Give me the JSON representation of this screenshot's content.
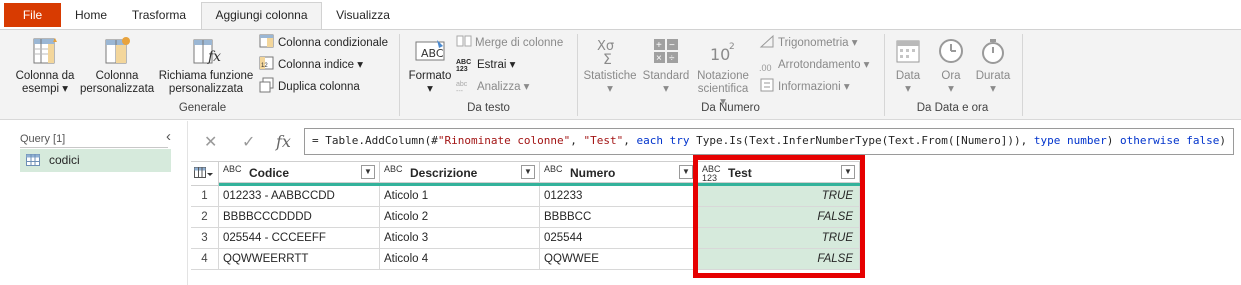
{
  "menu": {
    "tabs": [
      {
        "label": "File"
      },
      {
        "label": "Home"
      },
      {
        "label": "Trasforma"
      },
      {
        "label": "Aggiungi colonna"
      },
      {
        "label": "Visualizza"
      }
    ],
    "active_tab": "Aggiungi colonna",
    "file_color": "#d83b01"
  },
  "ribbon": {
    "generale": {
      "label": "Generale",
      "colonna_da_esempi": [
        "Colonna da",
        "esempi"
      ],
      "colonna_personalizzata": [
        "Colonna",
        "personalizzata"
      ],
      "richiama_funzione": [
        "Richiama funzione",
        "personalizzata"
      ],
      "colonna_condizionale": "Colonna condizionale",
      "colonna_indice": "Colonna indice",
      "duplica_colonna": "Duplica colonna"
    },
    "da_testo": {
      "label": "Da testo",
      "formato": "Formato",
      "merge_colonne": "Merge di colonne",
      "estrai": "Estrai",
      "analizza": "Analizza"
    },
    "da_numero": {
      "label": "Da Numero",
      "statistiche": "Statistiche",
      "standard": "Standard",
      "notazione_scientifica": [
        "Notazione",
        "scientifica"
      ],
      "trigonometria": "Trigonometria",
      "arrotondamento": "Arrotondamento",
      "informazioni": "Informazioni"
    },
    "da_data_ora": {
      "label": "Da Data e ora",
      "data": "Data",
      "ora": "Ora",
      "durata": "Durata"
    }
  },
  "query_pane": {
    "title": "Query [1]",
    "items": [
      {
        "label": "codici"
      }
    ]
  },
  "formula_bar": {
    "formula": "= Table.AddColumn(#\"Rinominate colonne\", \"Test\", each try Type.Is(Text.InferNumberType(Text.From([Numero])), type number) otherwise false)"
  },
  "grid": {
    "columns": [
      {
        "type_label": "ABC",
        "name": "Codice"
      },
      {
        "type_label": "ABC",
        "name": "Descrizione"
      },
      {
        "type_label": "ABC",
        "name": "Numero"
      },
      {
        "type_label": "ABC 123",
        "name": "Test"
      }
    ],
    "rows": [
      {
        "num": "1",
        "codice": "012233 - AABBCCDD",
        "descrizione": "Aticolo 1",
        "numero": "012233",
        "test": "TRUE"
      },
      {
        "num": "2",
        "codice": "BBBBCCCDDDD",
        "descrizione": "Aticolo 2",
        "numero": "BBBBCC",
        "test": "FALSE"
      },
      {
        "num": "3",
        "codice": "025544 - CCCEEFF",
        "descrizione": "Aticolo 3",
        "numero": "025544",
        "test": "TRUE"
      },
      {
        "num": "4",
        "codice": "QQWWEERRTT",
        "descrizione": "Aticolo 4",
        "numero": "QQWWEE",
        "test": "FALSE"
      }
    ],
    "highlight_color": "#e60000",
    "column_bar_color": "#33b29b"
  }
}
